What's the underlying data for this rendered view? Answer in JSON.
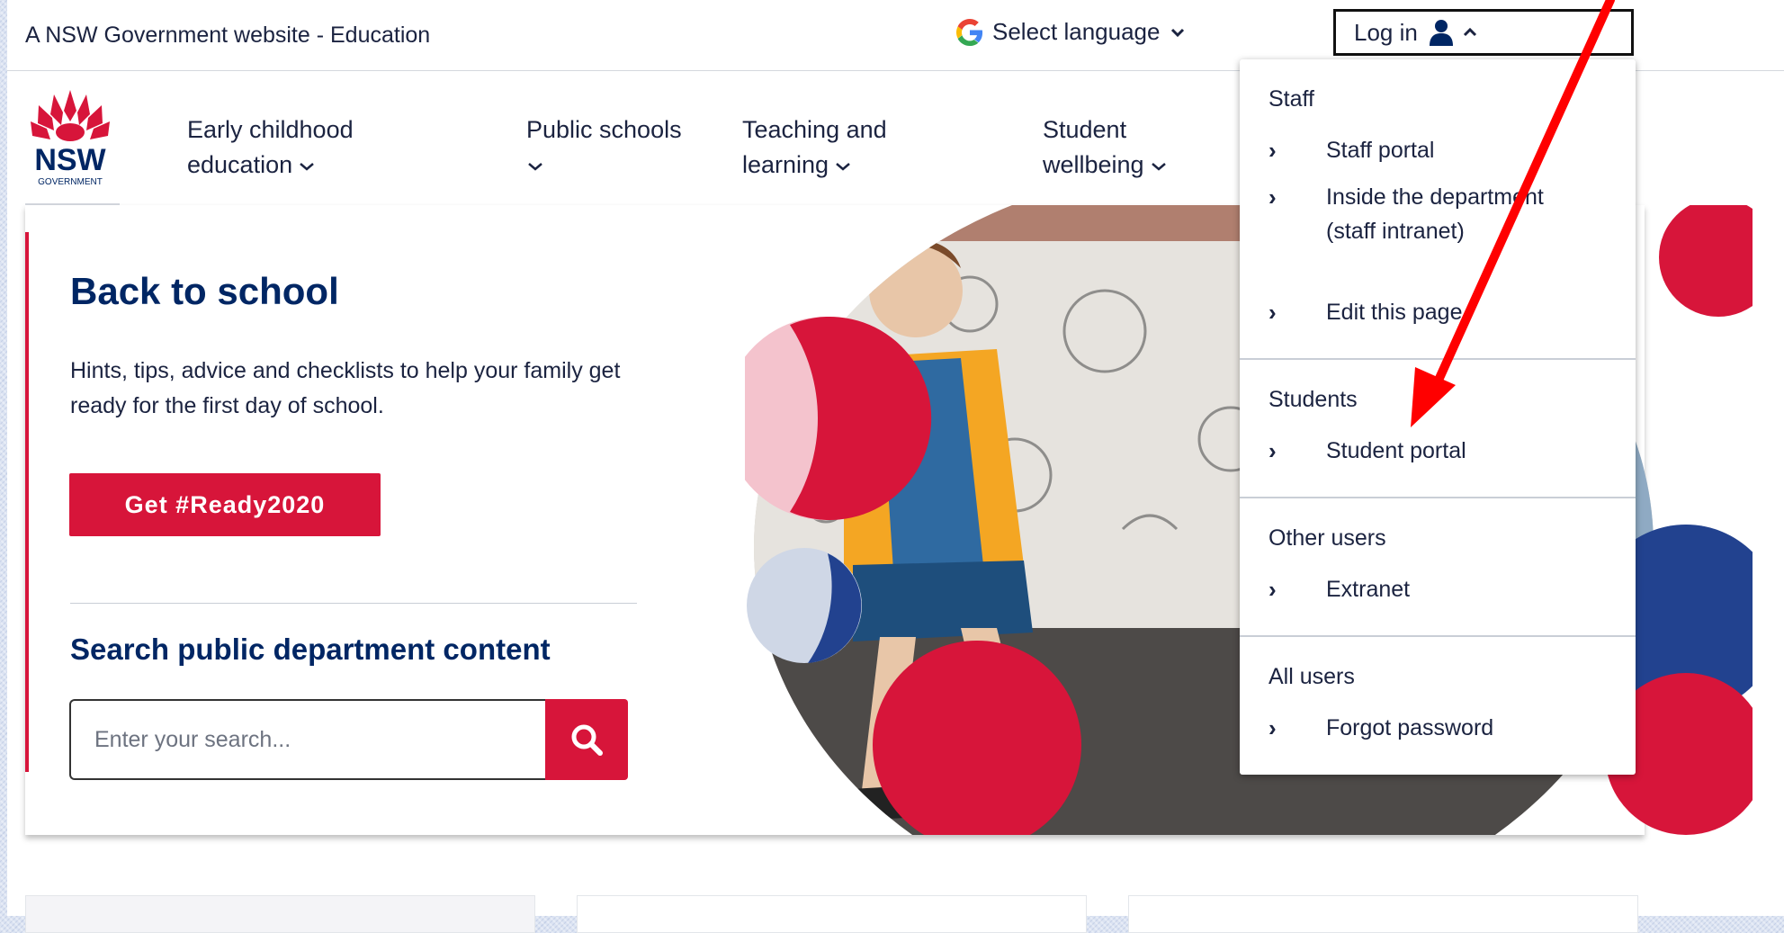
{
  "masthead": {
    "gov_text": "A NSW Government website - Education",
    "language_label": "Select language",
    "login_label": "Log in"
  },
  "logo": {
    "wordmark": "NSW",
    "subtext": "GOVERNMENT"
  },
  "nav": {
    "items": [
      {
        "label_line1": "Early childhood",
        "label_line2": "education"
      },
      {
        "label_line1": "Public schools",
        "label_line2": ""
      },
      {
        "label_line1": "Teaching and",
        "label_line2": "learning"
      },
      {
        "label_line1": "Student",
        "label_line2": "wellbeing"
      }
    ]
  },
  "hero": {
    "title": "Back to school",
    "description": "Hints, tips, advice and checklists to help your family get ready for the first day of school.",
    "cta_label": "Get #Ready2020",
    "search_title": "Search public department content",
    "search_placeholder": "Enter your search..."
  },
  "login_menu": {
    "staff": {
      "heading": "Staff",
      "items": [
        "Staff portal",
        "Inside the department (staff intranet)",
        "Edit this page"
      ]
    },
    "students": {
      "heading": "Students",
      "items": [
        "Student portal"
      ]
    },
    "other": {
      "heading": "Other users",
      "items": [
        "Extranet"
      ]
    },
    "all": {
      "heading": "All users",
      "items": [
        "Forgot password"
      ]
    }
  },
  "colors": {
    "brand_red": "#d7153a",
    "brand_navy": "#002664",
    "annotation_red": "#ff0000"
  },
  "icons": [
    "google-g-icon",
    "chevron-down-icon",
    "user-icon",
    "chevron-up-icon",
    "search-icon",
    "chevron-right-icon"
  ]
}
